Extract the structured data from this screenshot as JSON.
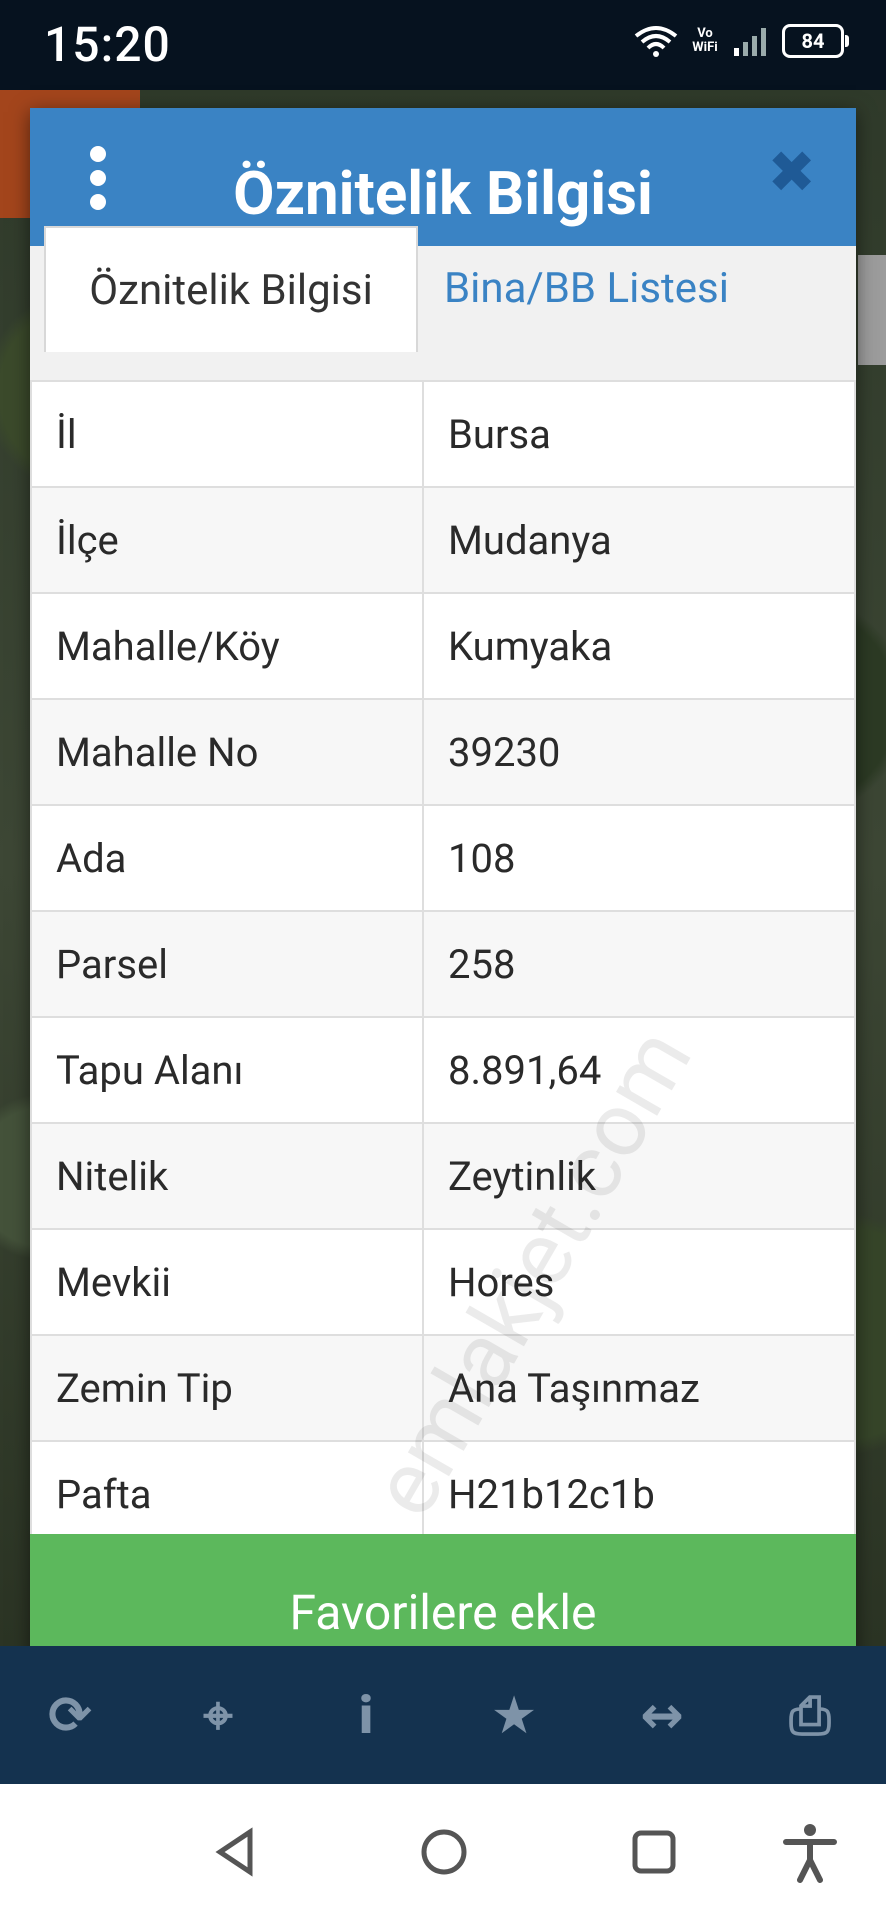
{
  "status_bar": {
    "time": "15:20",
    "battery": "84",
    "volte_label": "Vo WiFi"
  },
  "dialog": {
    "title": "Öznitelik Bilgisi",
    "tabs": [
      {
        "label": "Öznitelik Bilgisi",
        "active": true
      },
      {
        "label": "Bina/BB Listesi",
        "active": false
      }
    ],
    "rows": [
      {
        "key": "İl",
        "value": "Bursa"
      },
      {
        "key": "İlçe",
        "value": "Mudanya"
      },
      {
        "key": "Mahalle/Köy",
        "value": "Kumyaka"
      },
      {
        "key": "Mahalle No",
        "value": "39230"
      },
      {
        "key": "Ada",
        "value": "108"
      },
      {
        "key": "Parsel",
        "value": "258"
      },
      {
        "key": "Tapu Alanı",
        "value": "8.891,64"
      },
      {
        "key": "Nitelik",
        "value": "Zeytinlik"
      },
      {
        "key": "Mevkii",
        "value": "Hores"
      },
      {
        "key": "Zemin Tip",
        "value": "Ana Taşınmaz"
      },
      {
        "key": "Pafta",
        "value": "H21b12c1b"
      }
    ],
    "watermark": "emlakjet.com",
    "favorite_button": "Favorilere ekle"
  },
  "map_toolbar": [
    "refresh-icon",
    "locate-icon",
    "info-icon",
    "star-icon",
    "measure-icon",
    "print-icon"
  ],
  "navbar": [
    "back-icon",
    "home-icon",
    "recents-icon",
    "accessibility-icon"
  ],
  "colors": {
    "header": "#3a83c4",
    "favorite": "#5cb85c",
    "toolbar": "#14324f"
  }
}
